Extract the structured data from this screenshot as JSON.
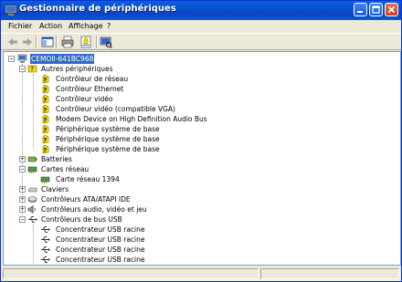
{
  "window": {
    "title": "Gestionnaire de périphériques"
  },
  "menu": [
    "Fichier",
    "Action",
    "Affichage",
    "?"
  ],
  "tree": {
    "root": "CEMOII-641BC968",
    "groups": [
      {
        "label": "Autres périphériques",
        "expanded": true,
        "items": [
          "Contrôleur de réseau",
          "Contrôleur Ethernet",
          "Contrôleur vidéo",
          "Contrôleur vidéo (compatible VGA)",
          "Modem Device on High Definition Audio Bus",
          "Périphérique système de base",
          "Périphérique système de base",
          "Périphérique système de base"
        ]
      },
      {
        "label": "Batteries",
        "expanded": false,
        "items": []
      },
      {
        "label": "Cartes réseau",
        "expanded": true,
        "items": [
          "Carte réseau 1394"
        ]
      },
      {
        "label": "Claviers",
        "expanded": false,
        "items": []
      },
      {
        "label": "Contrôleurs ATA/ATAPI IDE",
        "expanded": false,
        "items": []
      },
      {
        "label": "Contrôleurs audio, vidéo et jeu",
        "expanded": false,
        "items": []
      },
      {
        "label": "Contrôleurs de bus USB",
        "expanded": true,
        "items": [
          "Concentrateur USB racine",
          "Concentrateur USB racine",
          "Concentrateur USB racine",
          "Concentrateur USB racine"
        ]
      }
    ]
  },
  "colors": {
    "selection": "#316ac5",
    "titlebar": "#0a5fd9",
    "warning": "#f5d90a"
  }
}
